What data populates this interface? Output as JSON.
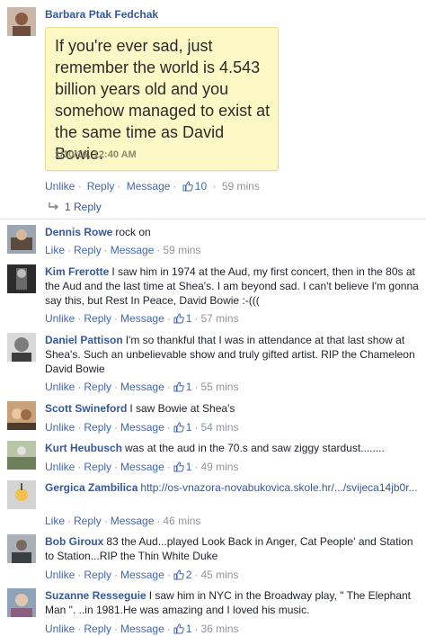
{
  "post": {
    "author": "Barbara Ptak Fedchak",
    "quote_lines": [
      "If you're ever sad, just",
      "remember the world is 4.543",
      "billion years old and you",
      "somehow managed to exist at",
      "the same time as David Bowie."
    ],
    "quote_date": "1/10/16, 12:40 AM",
    "actions": {
      "unlike": "Unlike",
      "reply": "Reply",
      "message": "Message",
      "like_count": "10",
      "time": "59 mins"
    },
    "replies_label": "1 Reply"
  },
  "comments": [
    {
      "author": "Dennis Rowe",
      "text": "rock on",
      "first": "Like",
      "likes": "",
      "time": "59 mins"
    },
    {
      "author": "Kim Frerotte",
      "text": "I saw him in 1974 at the Aud, my first concert, then in the 80s at the Aud and the last time at Shea's. I am beyond sad. I can't believe I'm gonna say this, but Rest In Peace, David Bowie :-(((",
      "first": "Unlike",
      "likes": "1",
      "time": "57 mins"
    },
    {
      "author": "Daniel Pattison",
      "text": "I'm so thankful that I was in attendance at that last show at Shea's. Such an unbelievable show and truly gifted artist. RIP the Chameleon David Bowie",
      "first": "Unlike",
      "likes": "1",
      "time": "55 mins"
    },
    {
      "author": "Scott Swineford",
      "text": "I saw Bowie at Shea's",
      "first": "Unlike",
      "likes": "1",
      "time": "54 mins"
    },
    {
      "author": "Kurt Heubusch",
      "text": "was at the aud in the 70.s and saw ziggy stardust........",
      "first": "Unlike",
      "likes": "1",
      "time": "49 mins"
    },
    {
      "author": "Gergica Zambilica",
      "text": "http://os-vnazora-novabukovica.skole.hr/.../svijeca14jb0r...",
      "first": "Like",
      "likes": "",
      "time": "46 mins"
    },
    {
      "author": "Bob Giroux",
      "text": "83 the Aud...played Look Back in Anger, Cat People' and Station to Station...RIP the Thin White Duke",
      "first": "Unlike",
      "likes": "2",
      "time": "45 mins"
    },
    {
      "author": "Suzanne Resseguie",
      "text": "I saw him in NYC in the Broadway play, \" The Elephant Man \". ..in 1981.He was amazing and I loved his music.",
      "first": "Unlike",
      "likes": "1",
      "time": "36 mins"
    }
  ],
  "labels": {
    "reply": "Reply",
    "message": "Message"
  },
  "colors": {
    "link": "#365899",
    "action": "#4267b2",
    "meta": "#90949c",
    "card": "#fdf9c6"
  }
}
